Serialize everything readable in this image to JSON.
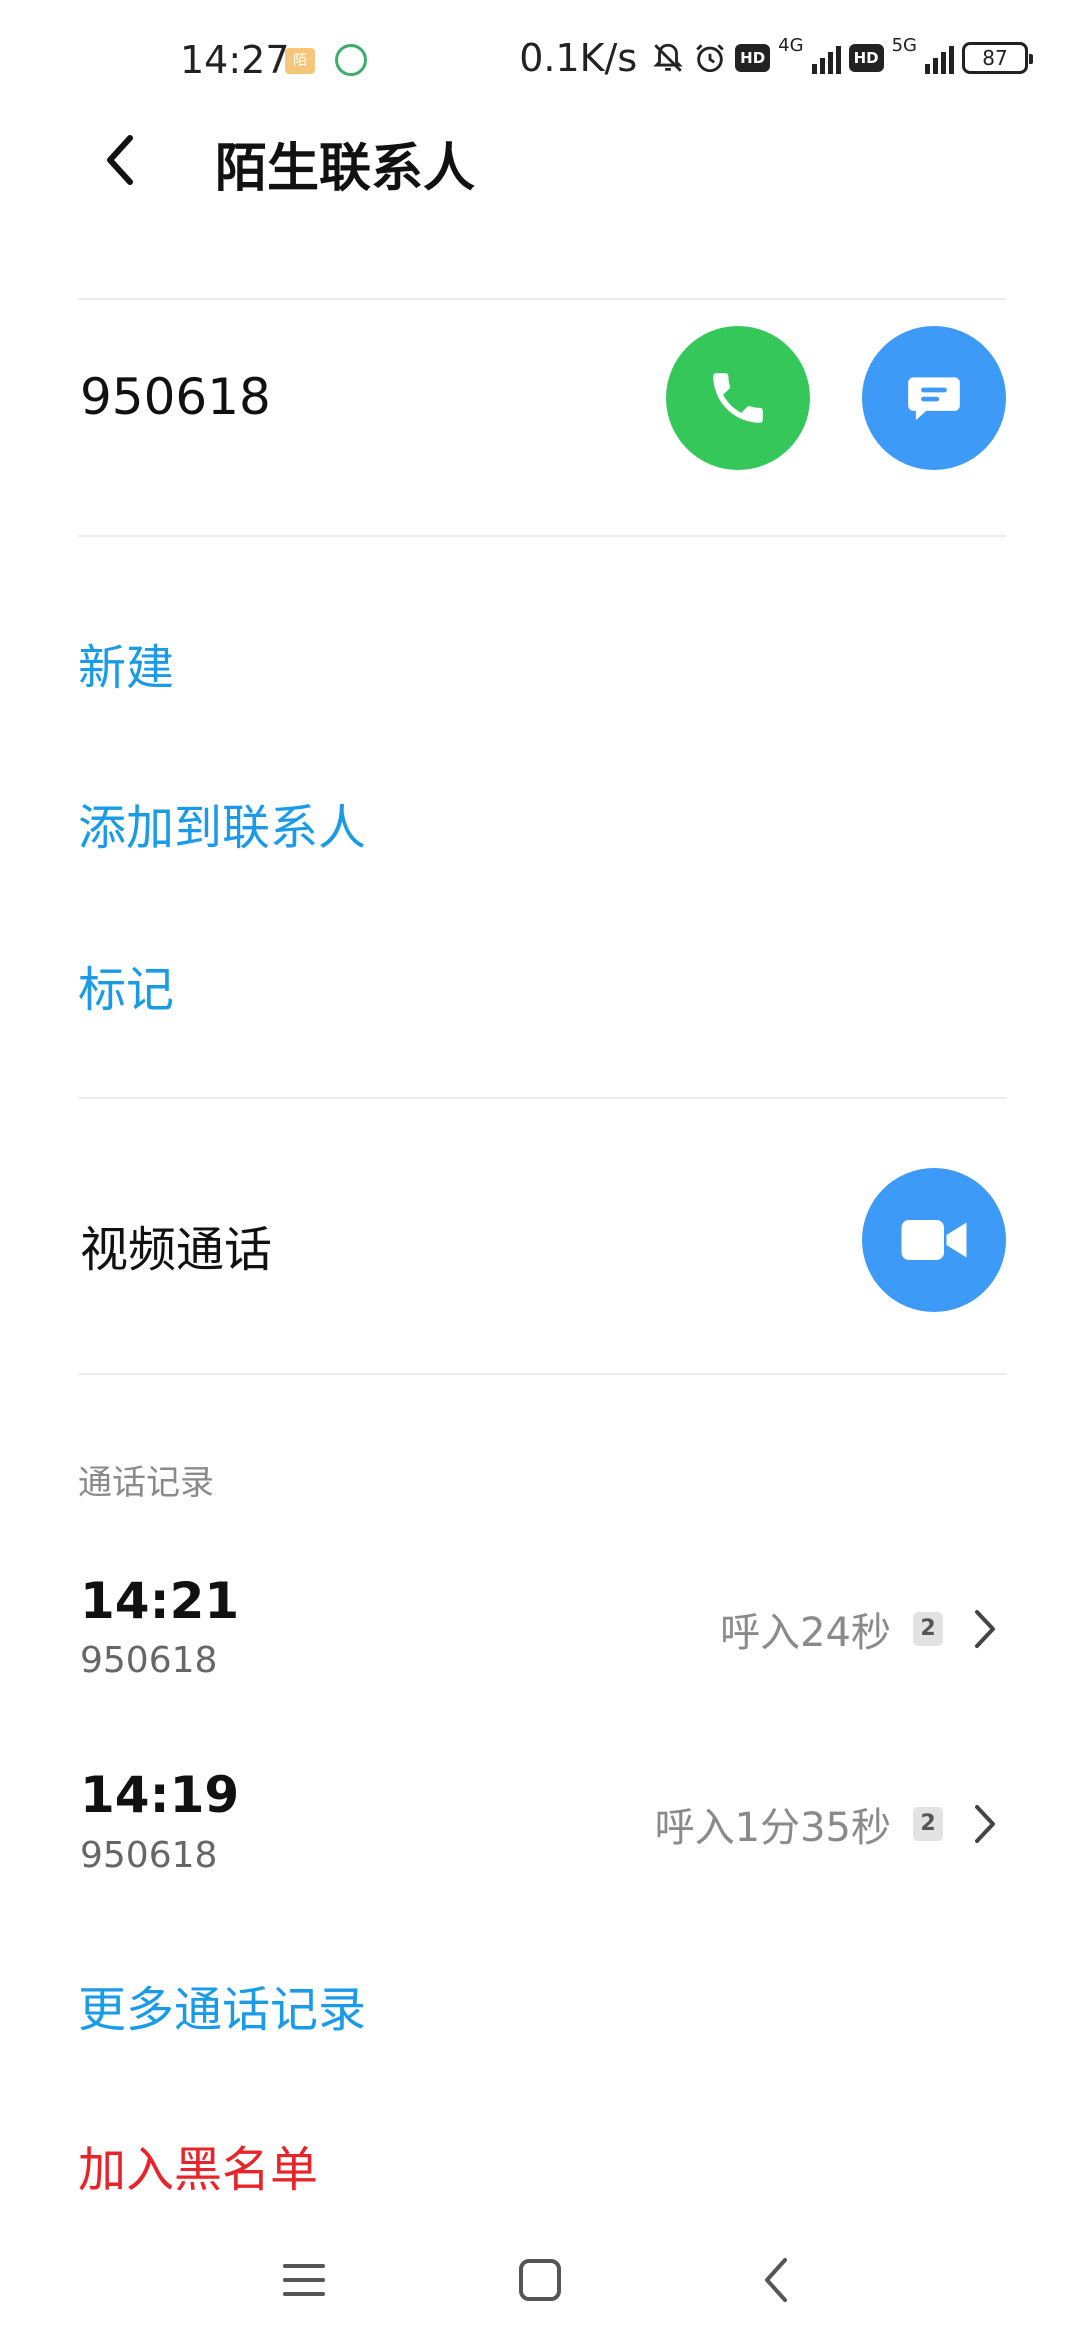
{
  "status_bar": {
    "time": "14:27",
    "speed": "0.1K/s",
    "net1": "4G",
    "net2": "5G",
    "hd": "HD",
    "battery": "87"
  },
  "header": {
    "title": "陌生联系人"
  },
  "contact": {
    "number": "950618"
  },
  "actions": {
    "new": "新建",
    "add_to_contacts": "添加到联系人",
    "mark": "标记"
  },
  "video": {
    "label": "视频通话"
  },
  "call_log": {
    "section_label": "通话记录",
    "entries": [
      {
        "time": "14:21",
        "number": "950618",
        "desc": "呼入24秒",
        "sim": "2"
      },
      {
        "time": "14:19",
        "number": "950618",
        "desc": "呼入1分35秒",
        "sim": "2"
      }
    ],
    "more": "更多通话记录"
  },
  "block": {
    "label": "加入黑名单"
  },
  "colors": {
    "accent_blue": "#1a9be8",
    "call_green": "#35c75a",
    "button_blue": "#3d9bf7",
    "danger_red": "#e8242a"
  }
}
